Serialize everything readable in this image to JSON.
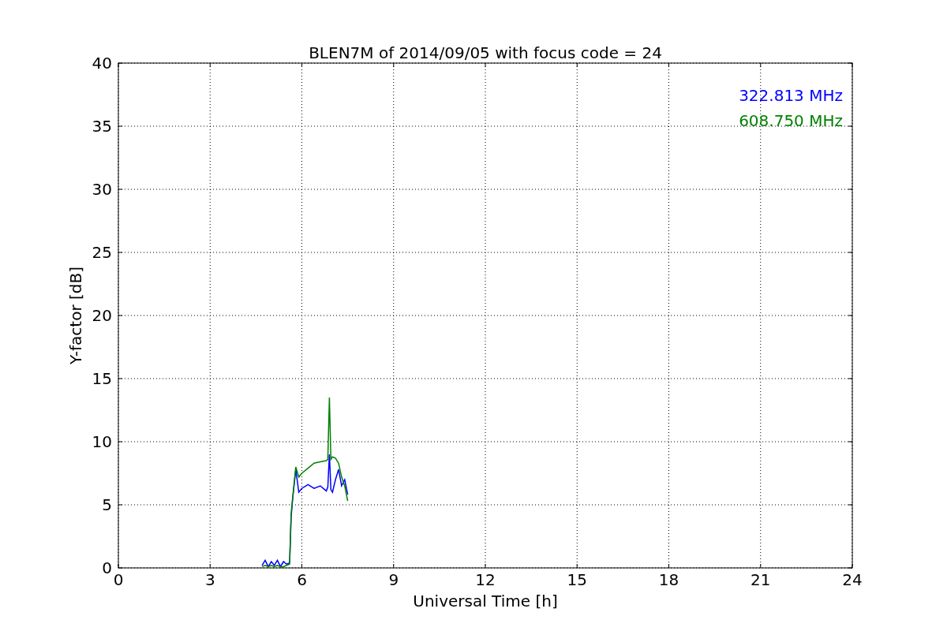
{
  "figure": {
    "chart_data": {
      "type": "line",
      "title": "BLEN7M of 2014/09/05 with focus code = 24",
      "xlabel": "Universal Time [h]",
      "ylabel": "Y-factor [dB]",
      "xlim": [
        0,
        24
      ],
      "ylim": [
        0,
        40
      ],
      "xticks": [
        0,
        3,
        6,
        9,
        12,
        15,
        18,
        21,
        24
      ],
      "yticks": [
        0,
        5,
        10,
        15,
        20,
        25,
        30,
        35,
        40
      ],
      "grid": true,
      "x": [
        4.7,
        4.8,
        4.9,
        5.0,
        5.1,
        5.2,
        5.3,
        5.4,
        5.5,
        5.6,
        5.65,
        5.7,
        5.8,
        5.9,
        6.0,
        6.2,
        6.4,
        6.6,
        6.8,
        6.85,
        6.9,
        6.95,
        7.0,
        7.1,
        7.2,
        7.3,
        7.4,
        7.5
      ],
      "series": [
        {
          "name": "322.813 MHz",
          "color": "#0000ff",
          "values": [
            0.2,
            0.6,
            0.1,
            0.5,
            0.2,
            0.6,
            0.1,
            0.5,
            0.3,
            0.4,
            4.0,
            5.5,
            7.8,
            6.0,
            6.3,
            6.6,
            6.3,
            6.5,
            6.1,
            6.4,
            9.0,
            6.2,
            6.0,
            7.0,
            7.8,
            6.5,
            7.0,
            5.8
          ]
        },
        {
          "name": "608.750 MHz",
          "color": "#008000",
          "values": [
            0.1,
            0.2,
            0.1,
            0.2,
            0.1,
            0.2,
            0.1,
            0.1,
            0.2,
            0.3,
            4.3,
            5.6,
            8.0,
            7.2,
            7.5,
            7.9,
            8.3,
            8.4,
            8.5,
            8.6,
            13.5,
            8.6,
            8.8,
            8.7,
            8.3,
            7.2,
            6.5,
            5.3
          ]
        }
      ]
    }
  }
}
